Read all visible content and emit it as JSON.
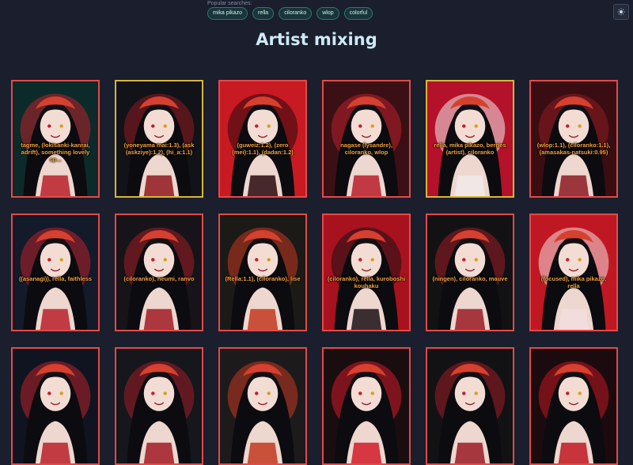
{
  "header": {
    "popular_label": "Popular searches:",
    "chips": [
      "mika pikazo",
      "rella",
      "ciloranko",
      "wlop",
      "colorful"
    ],
    "theme_icon": "sun-icon"
  },
  "page": {
    "title": "Artist mixing"
  },
  "cards": [
    {
      "caption": "tagme, (lokisanki-kanrai, adrift), something lovely sp...",
      "bg": "#0d2a2a",
      "accent": "#b8202a",
      "border": "red"
    },
    {
      "caption": "(yoneyama mai:1.3), (ask (askziye):1.2), (hi_a:1.1)",
      "bg": "#111318",
      "accent": "#8f1a1f",
      "border": "yellow"
    },
    {
      "caption": "(guweiz:1.2), (zero (mei):1.1), (dadan:1.2)",
      "bg": "#c81a22",
      "accent": "#2a0a0e",
      "border": "red"
    },
    {
      "caption": "nagase (lysandre), ciloranko, wlop",
      "bg": "#3a1014",
      "accent": "#b81f2a",
      "border": "red"
    },
    {
      "caption": "rella, mika pikazo, berries (artist), ciloranko",
      "bg": "#b3122a",
      "accent": "#f0eaea",
      "border": "yellow"
    },
    {
      "caption": "(wlop:1.1), (ciloranko:1.1), (amasakas-natsuki:0.95)",
      "bg": "#3a0d12",
      "accent": "#8c1b22",
      "border": "red"
    },
    {
      "caption": "((asanagi)), rella, faithless",
      "bg": "#131a2a",
      "accent": "#b8202a",
      "border": "red"
    },
    {
      "caption": "(ciloranko), neumi, ranvo",
      "bg": "#161419",
      "accent": "#a11b24",
      "border": "red"
    },
    {
      "caption": "(Rella:1.1), (ciloranko), lise",
      "bg": "#1b1a17",
      "accent": "#c2391f",
      "border": "red"
    },
    {
      "caption": "(ciloranko), rella, kuroboshi kouhaku",
      "bg": "#a8121f",
      "accent": "#1a1014",
      "border": "red"
    },
    {
      "caption": "(ningen), ciloranko, mauve",
      "bg": "#121214",
      "accent": "#9a1b24",
      "border": "red"
    },
    {
      "caption": "(focused), mika pikazo, rella",
      "bg": "#c01822",
      "accent": "#f2dede",
      "border": "red"
    },
    {
      "caption": "",
      "bg": "#0f1420",
      "accent": "#b8202a",
      "border": "red"
    },
    {
      "caption": "",
      "bg": "#15171d",
      "accent": "#a11b24",
      "border": "red"
    },
    {
      "caption": "",
      "bg": "#1c1a1b",
      "accent": "#c2391f",
      "border": "red"
    },
    {
      "caption": "",
      "bg": "#1a0d10",
      "accent": "#d01c28",
      "border": "red"
    },
    {
      "caption": "",
      "bg": "#121214",
      "accent": "#9a1b24",
      "border": "red"
    },
    {
      "caption": "",
      "bg": "#1b0b0e",
      "accent": "#c01822",
      "border": "red"
    }
  ]
}
